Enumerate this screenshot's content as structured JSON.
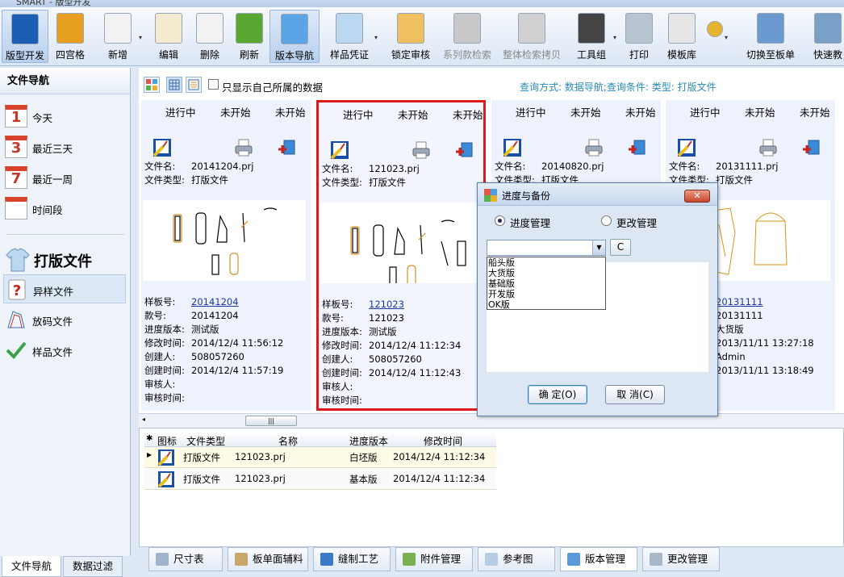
{
  "window": {
    "title": "SMART - 版型开发"
  },
  "toolbar": {
    "buttons": [
      {
        "label": "版型开发",
        "icon": "cad-icon",
        "color": "#1a5fb4"
      },
      {
        "label": "四宫格",
        "icon": "four-grid-icon",
        "color": "#e8a020"
      },
      {
        "label": "新增",
        "icon": "new-doc-icon",
        "color": "#f2f2f2"
      },
      {
        "label": "编辑",
        "icon": "edit-icon",
        "color": "#f4ead0"
      },
      {
        "label": "删除",
        "icon": "delete-icon",
        "color": "#f2f2f2"
      },
      {
        "label": "刷新",
        "icon": "refresh-icon",
        "color": "#5aa832"
      },
      {
        "label": "版本导航",
        "icon": "version-nav-icon",
        "color": "#5ba4e6"
      },
      {
        "label": "样品凭证",
        "icon": "shirt-icon",
        "color": "#bcd8f0"
      },
      {
        "label": "锁定审核",
        "icon": "lock-icon",
        "color": "#f0c060"
      },
      {
        "label": "系列款检索",
        "icon": "series-search-icon",
        "color": "#c8c8c8"
      },
      {
        "label": "整体检索拷贝",
        "icon": "copy-search-icon",
        "color": "#d0d0d0"
      },
      {
        "label": "工具组",
        "icon": "tools-icon",
        "color": "#444444"
      },
      {
        "label": "打印",
        "icon": "printer-icon",
        "color": "#b8c4d0"
      },
      {
        "label": "模板库",
        "icon": "template-icon",
        "color": "#e6e6e6"
      },
      {
        "label": "",
        "icon": "gear-icon",
        "color": "#e6b430"
      },
      {
        "label": "切换至板单",
        "icon": "switch-icon",
        "color": "#6a9ad0"
      },
      {
        "label": "快速教",
        "icon": "tutorial-icon",
        "color": "#7aa0c8"
      }
    ]
  },
  "left": {
    "header": "文件导航",
    "time_items": [
      {
        "label": "今天",
        "num": "1"
      },
      {
        "label": "最近三天",
        "num": "3"
      },
      {
        "label": "最近一周",
        "num": "7"
      },
      {
        "label": "时间段",
        "num": ""
      }
    ],
    "section_title": "打版文件",
    "file_items": [
      {
        "label": "异样文件",
        "icon": "question-icon"
      },
      {
        "label": "放码文件",
        "icon": "grading-icon"
      },
      {
        "label": "样品文件",
        "icon": "check-icon"
      }
    ],
    "tabs": [
      "文件导航",
      "数据过滤"
    ]
  },
  "content": {
    "only_mine": "只显示自己所属的数据",
    "query": "查询方式: 数据导航;查询条件: 类型: 打版文件",
    "status_labels": [
      "进行中",
      "未开始",
      "未开始"
    ],
    "field_labels": {
      "filename": "文件名:",
      "filetype": "文件类型:",
      "sample": "样板号:",
      "style": "款号:",
      "version": "进度版本:",
      "modified": "修改时间:",
      "creator": "创建人:",
      "created": "创建时间:",
      "reviewer": "审核人:",
      "reviewed": "审核时间:"
    },
    "cards": [
      {
        "filename": "20141204.prj",
        "filetype": "打版文件",
        "sample": "20141204",
        "style": "20141204",
        "version": "测试版",
        "modified": "2014/12/4 11:56:12",
        "creator": "508057260",
        "created": "2014/12/4 11:57:19",
        "reviewer": "",
        "reviewed": ""
      },
      {
        "filename": "121023.prj",
        "filetype": "打版文件",
        "sample": "121023",
        "style": "121023",
        "version": "测试版",
        "modified": "2014/12/4 11:12:34",
        "creator": "508057260",
        "created": "2014/12/4 11:12:43",
        "reviewer": "",
        "reviewed": ""
      },
      {
        "filename": "20140820.prj",
        "filetype": "打版文件"
      },
      {
        "filename": "20131111.prj",
        "filetype": "打版文件",
        "sample": "20131111",
        "style": "20131111",
        "version": "大货版",
        "modified": "2013/11/11 13:27:18",
        "creator": "Admin",
        "created": "2013/11/11 13:18:49"
      }
    ]
  },
  "grid": {
    "headers": [
      "图标",
      "文件类型",
      "名称",
      "进度版本",
      "修改时间"
    ],
    "rows": [
      {
        "type": "打版文件",
        "name": "121023.prj",
        "version": "白坯版",
        "time": "2014/12/4 11:12:34"
      },
      {
        "type": "打版文件",
        "name": "121023.prj",
        "version": "基本版",
        "time": "2014/12/4 11:12:34"
      }
    ]
  },
  "bottom_tabs": [
    "尺寸表",
    "板单面辅料",
    "缝制工艺",
    "附件管理",
    "参考图",
    "版本管理",
    "更改管理"
  ],
  "dialog": {
    "title": "进度与备份",
    "radio1": "进度管理",
    "radio2": "更改管理",
    "combo_value": "",
    "c_button": "C",
    "options": [
      "船头版",
      "大货版",
      "基础版",
      "开发版",
      "OK版"
    ],
    "ok": "确 定(O)",
    "cancel": "取 消(C)"
  },
  "colors": {
    "accent": "#2a8bb7",
    "selected_border": "#e0191f",
    "link": "#1a37a8"
  }
}
